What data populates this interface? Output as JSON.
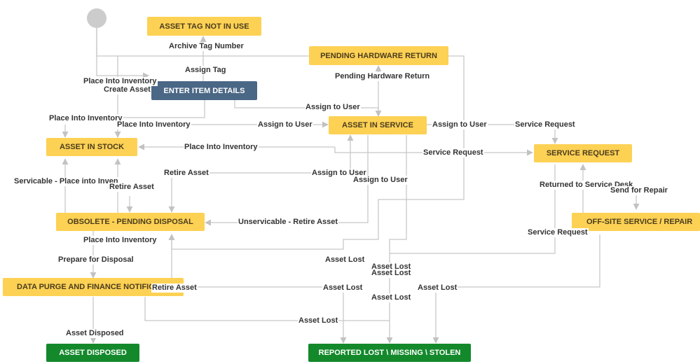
{
  "statuses": {
    "asset_tag_not_in_use": "ASSET TAG NOT IN USE",
    "pending_hardware_return": "PENDING HARDWARE RETURN",
    "enter_item_details": "ENTER ITEM DETAILS",
    "asset_in_service": "ASSET IN SERVICE",
    "asset_in_stock": "ASSET IN STOCK",
    "service_request": "SERVICE REQUEST",
    "obsolete_pending_disposal": "OBSOLETE - PENDING DISPOSAL",
    "off_site_service_repair": "OFF-SITE SERVICE / REPAIR",
    "data_purge_finance": "DATA PURGE AND FINANCE NOTIFICATION",
    "asset_disposed": "ASSET DISPOSED",
    "reported_lost": "REPORTED LOST \\ MISSING \\ STOLEN"
  },
  "transitions": [
    "Archive Tag Number",
    "Assign Tag",
    "Pending Hardware Return",
    "Place Into Inventory",
    "Create Asset",
    "Assign to User",
    "Place Into Inventory",
    "Place Into Inventory",
    "Assign to User",
    "Assign to User",
    "Service Request",
    "Place Into Inventory",
    "Service Request",
    "Retire Asset",
    "Assign to User",
    "Assign to User",
    "Servicable - Place into Inven",
    "Retire Asset",
    "Returned to Service Desk",
    "Send for Repair",
    "Unservicable - Retire Asset",
    "Service Request",
    "Place Into Inventory",
    "Prepare for Disposal",
    "Asset Lost",
    "Asset Lost",
    "Asset Lost",
    "Retire Asset",
    "Asset Lost",
    "Asset Lost",
    "Asset Lost",
    "Asset Lost",
    "Asset Disposed"
  ]
}
